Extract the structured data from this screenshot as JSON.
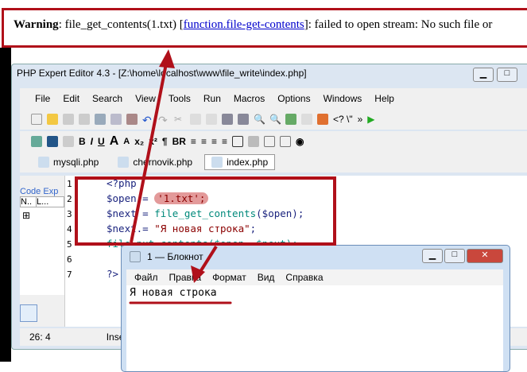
{
  "warning": {
    "label": "Warning",
    "text1": ": file_get_contents(1.txt) [",
    "link": "function.file-get-contents",
    "text2": "]: failed to open stream: No such file or"
  },
  "editor": {
    "title": "PHP Expert Editor 4.3 - [Z:\\home\\localhost\\www\\file_write\\index.php]",
    "menu": [
      "File",
      "Edit",
      "Search",
      "View",
      "Tools",
      "Run",
      "Macros",
      "Options",
      "Windows",
      "Help"
    ],
    "format_buttons": [
      "B",
      "I",
      "U",
      "A",
      "A",
      "x₂",
      "x²",
      "¶",
      "BR"
    ],
    "tabs": [
      "mysqli.php",
      "chernovik.php",
      "index.php"
    ],
    "panel": {
      "title": "Code Exp",
      "cols": [
        "N..",
        "L..."
      ]
    },
    "lines": [
      "1",
      "2",
      "3",
      "4",
      "5",
      "6",
      "7"
    ],
    "code": {
      "l1": "<?php",
      "l2a": "$open = ",
      "l2b": "'1.txt';",
      "l3a": "$next = ",
      "l3b": "file_get_contents",
      "l3c": "($open);",
      "l4a": "$next.= ",
      "l4b": "\"Я новая строка\"",
      "l4c": ";",
      "l5": "file_put_contents($open, $next);",
      "l7": "?>"
    },
    "status": {
      "pos": "26: 4",
      "mode": "Insert"
    }
  },
  "notepad": {
    "title": "1 — Блокнот",
    "menu": [
      "Файл",
      "Правка",
      "Формат",
      "Вид",
      "Справка"
    ],
    "content": "Я новая строка"
  },
  "colors": {
    "annotation": "#b0101a"
  }
}
